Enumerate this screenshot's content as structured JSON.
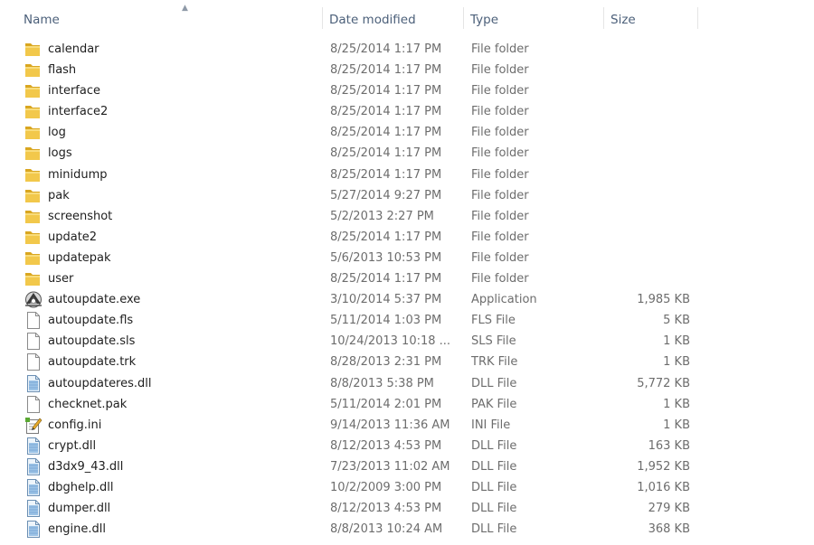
{
  "columns": {
    "name": "Name",
    "date": "Date modified",
    "type": "Type",
    "size": "Size"
  },
  "files": [
    {
      "name": "calendar",
      "date": "8/25/2014 1:17 PM",
      "type": "File folder",
      "size": "",
      "icon": "folder-icon"
    },
    {
      "name": "flash",
      "date": "8/25/2014 1:17 PM",
      "type": "File folder",
      "size": "",
      "icon": "folder-icon"
    },
    {
      "name": "interface",
      "date": "8/25/2014 1:17 PM",
      "type": "File folder",
      "size": "",
      "icon": "folder-icon"
    },
    {
      "name": "interface2",
      "date": "8/25/2014 1:17 PM",
      "type": "File folder",
      "size": "",
      "icon": "folder-icon"
    },
    {
      "name": "log",
      "date": "8/25/2014 1:17 PM",
      "type": "File folder",
      "size": "",
      "icon": "folder-icon"
    },
    {
      "name": "logs",
      "date": "8/25/2014 1:17 PM",
      "type": "File folder",
      "size": "",
      "icon": "folder-icon"
    },
    {
      "name": "minidump",
      "date": "8/25/2014 1:17 PM",
      "type": "File folder",
      "size": "",
      "icon": "folder-icon"
    },
    {
      "name": "pak",
      "date": "5/27/2014 9:27 PM",
      "type": "File folder",
      "size": "",
      "icon": "folder-icon"
    },
    {
      "name": "screenshot",
      "date": "5/2/2013 2:27 PM",
      "type": "File folder",
      "size": "",
      "icon": "folder-icon"
    },
    {
      "name": "update2",
      "date": "8/25/2014 1:17 PM",
      "type": "File folder",
      "size": "",
      "icon": "folder-icon"
    },
    {
      "name": "updatepak",
      "date": "5/6/2013 10:53 PM",
      "type": "File folder",
      "size": "",
      "icon": "folder-icon"
    },
    {
      "name": "user",
      "date": "8/25/2014 1:17 PM",
      "type": "File folder",
      "size": "",
      "icon": "folder-icon"
    },
    {
      "name": "autoupdate.exe",
      "date": "3/10/2014 5:37 PM",
      "type": "Application",
      "size": "1,985 KB",
      "icon": "application-icon"
    },
    {
      "name": "autoupdate.fls",
      "date": "5/11/2014 1:03 PM",
      "type": "FLS File",
      "size": "5 KB",
      "icon": "file-icon"
    },
    {
      "name": "autoupdate.sls",
      "date": "10/24/2013 10:18 ...",
      "type": "SLS File",
      "size": "1 KB",
      "icon": "file-icon"
    },
    {
      "name": "autoupdate.trk",
      "date": "8/28/2013 2:31 PM",
      "type": "TRK File",
      "size": "1 KB",
      "icon": "file-icon"
    },
    {
      "name": "autoupdateres.dll",
      "date": "8/8/2013 5:38 PM",
      "type": "DLL File",
      "size": "5,772 KB",
      "icon": "dll-icon"
    },
    {
      "name": "checknet.pak",
      "date": "5/11/2014 2:01 PM",
      "type": "PAK File",
      "size": "1 KB",
      "icon": "file-icon"
    },
    {
      "name": "config.ini",
      "date": "9/14/2013 11:36 AM",
      "type": "INI File",
      "size": "1 KB",
      "icon": "ini-file-icon"
    },
    {
      "name": "crypt.dll",
      "date": "8/12/2013 4:53 PM",
      "type": "DLL File",
      "size": "163 KB",
      "icon": "dll-icon"
    },
    {
      "name": "d3dx9_43.dll",
      "date": "7/23/2013 11:02 AM",
      "type": "DLL File",
      "size": "1,952 KB",
      "icon": "dll-icon"
    },
    {
      "name": "dbghelp.dll",
      "date": "10/2/2009 3:00 PM",
      "type": "DLL File",
      "size": "1,016 KB",
      "icon": "dll-icon"
    },
    {
      "name": "dumper.dll",
      "date": "8/12/2013 4:53 PM",
      "type": "DLL File",
      "size": "279 KB",
      "icon": "dll-icon"
    },
    {
      "name": "engine.dll",
      "date": "8/8/2013 10:24 AM",
      "type": "DLL File",
      "size": "368 KB",
      "icon": "dll-icon"
    }
  ]
}
